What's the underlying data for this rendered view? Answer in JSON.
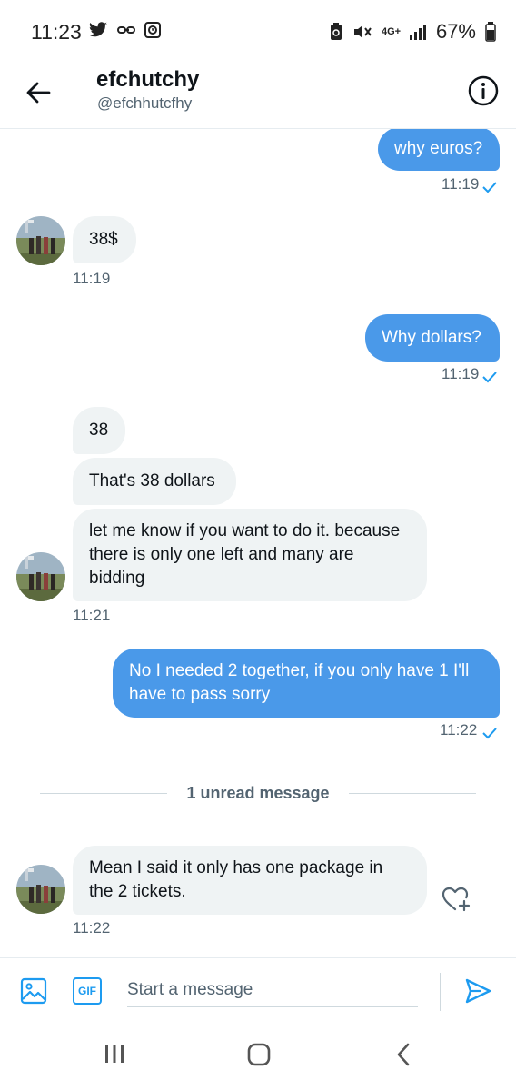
{
  "status_bar": {
    "time": "11:23",
    "network": "4G+",
    "battery": "67%"
  },
  "header": {
    "name": "efchutchy",
    "handle": "@efchhutcfhy"
  },
  "messages": [
    {
      "direction": "out",
      "lines": [
        "why euros?"
      ],
      "time": "11:19"
    },
    {
      "direction": "in",
      "lines": [
        "38$"
      ],
      "time": "11:19"
    },
    {
      "direction": "out",
      "lines": [
        "Why dollars?"
      ],
      "time": "11:19"
    },
    {
      "direction": "in",
      "lines": [
        "38"
      ]
    },
    {
      "direction": "in",
      "lines": [
        "That's 38 dollars"
      ]
    },
    {
      "direction": "in",
      "lines": [
        "let me know if you want to do it. because",
        "there is only one left and many are",
        "bidding"
      ],
      "time": "11:21"
    },
    {
      "direction": "out",
      "lines": [
        "No I needed 2 together, if you only have 1 I'll",
        "have to pass sorry"
      ],
      "time": "11:22"
    },
    {
      "direction": "in",
      "lines": [
        "Mean I said it only has one package in",
        "the 2 tickets."
      ],
      "time": "11:22"
    }
  ],
  "divider": {
    "label": "1 unread message"
  },
  "composer": {
    "placeholder": "Start a message",
    "gif_label": "GIF"
  },
  "colors": {
    "accent": "#1d9bf0",
    "outgoing_bubble": "#4a99e9",
    "incoming_bubble": "#eff3f4"
  },
  "icons": [
    "back-arrow-icon",
    "info-icon",
    "image-icon",
    "gif-icon",
    "send-icon",
    "heart-plus-icon",
    "read-check-icon",
    "recents-icon",
    "home-icon",
    "nav-back-icon"
  ]
}
